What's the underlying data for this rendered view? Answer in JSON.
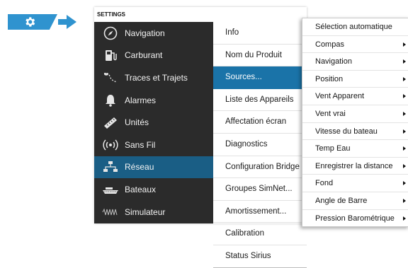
{
  "panel": {
    "title": "SETTINGS"
  },
  "categories": [
    {
      "label": "Navigation",
      "icon": "compass-icon"
    },
    {
      "label": "Carburant",
      "icon": "fuel-pump-icon"
    },
    {
      "label": "Traces et Trajets",
      "icon": "trails-icon"
    },
    {
      "label": "Alarmes",
      "icon": "bell-icon"
    },
    {
      "label": "Unités",
      "icon": "ruler-icon"
    },
    {
      "label": "Sans Fil",
      "icon": "wireless-icon"
    },
    {
      "label": "Réseau",
      "icon": "network-icon"
    },
    {
      "label": "Bateaux",
      "icon": "boats-icon"
    },
    {
      "label": "Simulateur",
      "icon": "simulator-wave-icon"
    }
  ],
  "active_category": "Réseau",
  "network_items": [
    {
      "label": "Info"
    },
    {
      "label": "Nom du Produit"
    },
    {
      "label": "Sources..."
    },
    {
      "label": "Liste des Appareils"
    },
    {
      "label": "Affectation écran"
    },
    {
      "label": "Diagnostics"
    },
    {
      "label": "Configuration Bridge"
    },
    {
      "label": "Groupes SimNet..."
    },
    {
      "label": "Amortissement..."
    },
    {
      "label": "Calibration"
    },
    {
      "label": "Status Sirius"
    }
  ],
  "active_network_item": "Sources...",
  "sources_menu": [
    {
      "label": "Sélection automatique",
      "has_submenu": false
    },
    {
      "label": "Compas",
      "has_submenu": true
    },
    {
      "label": "Navigation",
      "has_submenu": true
    },
    {
      "label": "Position",
      "has_submenu": true
    },
    {
      "label": "Vent Apparent",
      "has_submenu": true
    },
    {
      "label": "Vent vrai",
      "has_submenu": true
    },
    {
      "label": "Vitesse du bateau",
      "has_submenu": true
    },
    {
      "label": "Temp Eau",
      "has_submenu": true
    },
    {
      "label": "Enregistrer la distance",
      "has_submenu": true
    },
    {
      "label": "Fond",
      "has_submenu": true
    },
    {
      "label": "Angle de Barre",
      "has_submenu": true
    },
    {
      "label": "Pression Barométrique",
      "has_submenu": true
    }
  ],
  "colors": {
    "accent_blue": "#2f93cf",
    "active_category_bg": "#1a5e85",
    "active_item_bg": "#1a73a8",
    "panel_dark": "#2c2c2c"
  }
}
